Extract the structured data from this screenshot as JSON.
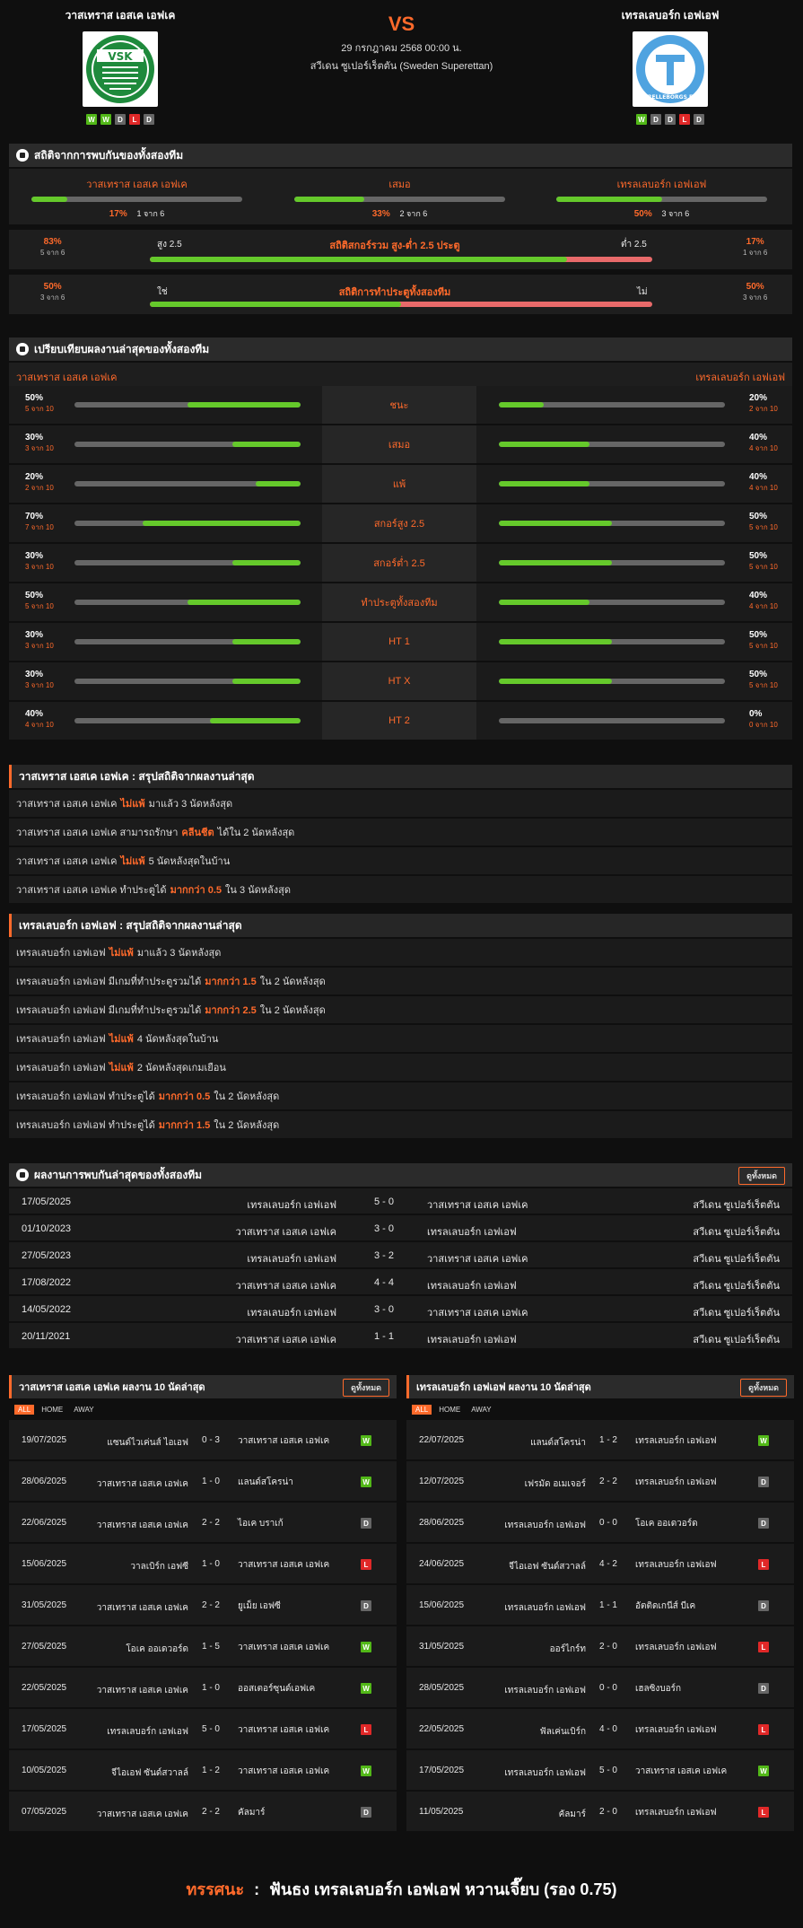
{
  "header": {
    "home": "วาสเทราส เอสเค เอฟเค",
    "away": "เทรลเลบอร์ก เอฟเอฟ",
    "vs": "VS",
    "date": "29 กรกฎาคม 2568 00:00 น.",
    "league": "สวีเดน ซูเปอร์เร็ตตัน (Sweden Superettan)",
    "home_form": [
      "W",
      "W",
      "D",
      "L",
      "D"
    ],
    "away_form": [
      "W",
      "D",
      "D",
      "L",
      "D"
    ],
    "home_logo_text": "VSK",
    "away_logo_text": "TRELLEBORGS FF"
  },
  "h2h_stats": {
    "title": "สถิติจากการพบกันของทั้งสองทีม",
    "home_label": "วาสเทราส เอสเค เอฟเค",
    "draw_label": "เสมอ",
    "away_label": "เทรลเลบอร์ก เอฟเอฟ",
    "home_pct": "17%",
    "home_cnt": "1 จาก 6",
    "draw_pct": "33%",
    "draw_cnt": "2 จาก 6",
    "away_pct": "50%",
    "away_cnt": "3 จาก 6",
    "home_frac": 0.17,
    "draw_frac": 0.33,
    "away_frac": 0.5,
    "ou": {
      "title": "สถิติสกอร์รวม สูง-ต่ำ 2.5 ประตู",
      "left_pct": "83%",
      "left_cnt": "5 จาก 6",
      "right_pct": "17%",
      "right_cnt": "1 จาก 6",
      "over": "สูง 2.5",
      "under": "ต่ำ 2.5",
      "frac": 0.83
    },
    "btts": {
      "title": "สถิติการทำประตูทั้งสองทีม",
      "left_pct": "50%",
      "left_cnt": "3 จาก 6",
      "right_pct": "50%",
      "right_cnt": "3 จาก 6",
      "yes": "ใช่",
      "no": "ไม่",
      "frac": 0.5
    }
  },
  "compare": {
    "title": "เปรียบเทียบผลงานล่าสุดของทั้งสองทีม",
    "home": "วาสเทราส เอสเค เอฟเค",
    "away": "เทรลเลบอร์ก เอฟเอฟ",
    "rows": [
      {
        "label": "ชนะ",
        "hp": "50%",
        "hc": "5 จาก 10",
        "hf": 0.5,
        "ap": "20%",
        "ac": "2 จาก 10",
        "af": 0.2
      },
      {
        "label": "เสมอ",
        "hp": "30%",
        "hc": "3 จาก 10",
        "hf": 0.3,
        "ap": "40%",
        "ac": "4 จาก 10",
        "af": 0.4
      },
      {
        "label": "แพ้",
        "hp": "20%",
        "hc": "2 จาก 10",
        "hf": 0.2,
        "ap": "40%",
        "ac": "4 จาก 10",
        "af": 0.4
      },
      {
        "label": "สกอร์สูง 2.5",
        "hp": "70%",
        "hc": "7 จาก 10",
        "hf": 0.7,
        "ap": "50%",
        "ac": "5 จาก 10",
        "af": 0.5
      },
      {
        "label": "สกอร์ต่ำ 2.5",
        "hp": "30%",
        "hc": "3 จาก 10",
        "hf": 0.3,
        "ap": "50%",
        "ac": "5 จาก 10",
        "af": 0.5
      },
      {
        "label": "ทำประตูทั้งสองทีม",
        "hp": "50%",
        "hc": "5 จาก 10",
        "hf": 0.5,
        "ap": "40%",
        "ac": "4 จาก 10",
        "af": 0.4
      },
      {
        "label": "HT 1",
        "hp": "30%",
        "hc": "3 จาก 10",
        "hf": 0.3,
        "ap": "50%",
        "ac": "5 จาก 10",
        "af": 0.5
      },
      {
        "label": "HT X",
        "hp": "30%",
        "hc": "3 จาก 10",
        "hf": 0.3,
        "ap": "50%",
        "ac": "5 จาก 10",
        "af": 0.5
      },
      {
        "label": "HT 2",
        "hp": "40%",
        "hc": "4 จาก 10",
        "hf": 0.4,
        "ap": "0%",
        "ac": "0 จาก 10",
        "af": 0
      }
    ]
  },
  "summary_home": {
    "title": "วาสเทราส เอสเค เอฟเค : สรุปสถิติจากผลงานล่าสุด",
    "items": [
      [
        "วาสเทราส เอสเค เอฟเค",
        "ไม่แพ้",
        "มาแล้ว 3 นัดหลังสุด"
      ],
      [
        "วาสเทราส เอสเค เอฟเค สามารถรักษา",
        "คลีนชีต",
        "ได้ใน 2 นัดหลังสุด"
      ],
      [
        "วาสเทราส เอสเค เอฟเค",
        "ไม่แพ้",
        "5 นัดหลังสุดในบ้าน"
      ],
      [
        "วาสเทราส เอสเค เอฟเค ทำประตูได้",
        "มากกว่า 0.5",
        "ใน 3 นัดหลังสุด"
      ]
    ]
  },
  "summary_away": {
    "title": "เทรลเลบอร์ก เอฟเอฟ : สรุปสถิติจากผลงานล่าสุด",
    "items": [
      [
        "เทรลเลบอร์ก เอฟเอฟ",
        "ไม่แพ้",
        "มาแล้ว 3 นัดหลังสุด"
      ],
      [
        "เทรลเลบอร์ก เอฟเอฟ มีเกมที่ทำประตูรวมได้",
        "มากกว่า 1.5",
        "ใน 2 นัดหลังสุด"
      ],
      [
        "เทรลเลบอร์ก เอฟเอฟ มีเกมที่ทำประตูรวมได้",
        "มากกว่า 2.5",
        "ใน 2 นัดหลังสุด"
      ],
      [
        "เทรลเลบอร์ก เอฟเอฟ",
        "ไม่แพ้",
        "4 นัดหลังสุดในบ้าน"
      ],
      [
        "เทรลเลบอร์ก เอฟเอฟ",
        "ไม่แพ้",
        "2 นัดหลังสุดเกมเยือน"
      ],
      [
        "เทรลเลบอร์ก เอฟเอฟ ทำประตูได้",
        "มากกว่า 0.5",
        "ใน 2 นัดหลังสุด"
      ],
      [
        "เทรลเลบอร์ก เอฟเอฟ ทำประตูได้",
        "มากกว่า 1.5",
        "ใน 2 นัดหลังสุด"
      ]
    ]
  },
  "h2h_results": {
    "title": "ผลงานการพบกันล่าสุดของทั้งสองทีม",
    "all_btn": "ดูทั้งหมด",
    "rows": [
      [
        "17/05/2025",
        "เทรลเลบอร์ก เอฟเอฟ",
        "5 - 0",
        "วาสเทราส เอสเค เอฟเค",
        "สวีเดน ซูเปอร์เร็ตตัน"
      ],
      [
        "01/10/2023",
        "วาสเทราส เอสเค เอฟเค",
        "3 - 0",
        "เทรลเลบอร์ก เอฟเอฟ",
        "สวีเดน ซูเปอร์เร็ตตัน"
      ],
      [
        "27/05/2023",
        "เทรลเลบอร์ก เอฟเอฟ",
        "3 - 2",
        "วาสเทราส เอสเค เอฟเค",
        "สวีเดน ซูเปอร์เร็ตตัน"
      ],
      [
        "17/08/2022",
        "วาสเทราส เอสเค เอฟเค",
        "4 - 4",
        "เทรลเลบอร์ก เอฟเอฟ",
        "สวีเดน ซูเปอร์เร็ตตัน"
      ],
      [
        "14/05/2022",
        "เทรลเลบอร์ก เอฟเอฟ",
        "3 - 0",
        "วาสเทราส เอสเค เอฟเค",
        "สวีเดน ซูเปอร์เร็ตตัน"
      ],
      [
        "20/11/2021",
        "วาสเทราส เอสเค เอฟเค",
        "1 - 1",
        "เทรลเลบอร์ก เอฟเอฟ",
        "สวีเดน ซูเปอร์เร็ตตัน"
      ]
    ]
  },
  "last_home": {
    "title": "วาสเทราส เอสเค เอฟเค ผลงาน 10 นัดล่าสุด",
    "all_btn": "ดูทั้งหมด",
    "tabs": [
      "ALL",
      "HOME",
      "AWAY"
    ],
    "rows": [
      [
        "19/07/2025",
        "แซนด์ไวเค่นส์ ไอเอฟ",
        "0 - 3",
        "วาสเทราส เอสเค เอฟเค",
        "W"
      ],
      [
        "28/06/2025",
        "วาสเทราส เอสเค เอฟเค",
        "1 - 0",
        "แลนด์สโครน่า",
        "W"
      ],
      [
        "22/06/2025",
        "วาสเทราส เอสเค เอฟเค",
        "2 - 2",
        "ไอเค บราเก้",
        "D"
      ],
      [
        "15/06/2025",
        "วาลเบิร์ก เอฟซี",
        "1 - 0",
        "วาสเทราส เอสเค เอฟเค",
        "L"
      ],
      [
        "31/05/2025",
        "วาสเทราส เอสเค เอฟเค",
        "2 - 2",
        "ยูเม็ย เอฟซี",
        "D"
      ],
      [
        "27/05/2025",
        "โอเค ออเดวอร์ด",
        "1 - 5",
        "วาสเทราส เอสเค เอฟเค",
        "W"
      ],
      [
        "22/05/2025",
        "วาสเทราส เอสเค เอฟเค",
        "1 - 0",
        "ออสเตอร์ซุนด์เอฟเค",
        "W"
      ],
      [
        "17/05/2025",
        "เทรลเลบอร์ก เอฟเอฟ",
        "5 - 0",
        "วาสเทราส เอสเค เอฟเค",
        "L"
      ],
      [
        "10/05/2025",
        "จีไอเอฟ ซันด์สวาลล์",
        "1 - 2",
        "วาสเทราส เอสเค เอฟเค",
        "W"
      ],
      [
        "07/05/2025",
        "วาสเทราส เอสเค เอฟเค",
        "2 - 2",
        "คัลมาร์",
        "D"
      ]
    ]
  },
  "last_away": {
    "title": "เทรลเลบอร์ก เอฟเอฟ ผลงาน 10 นัดล่าสุด",
    "all_btn": "ดูทั้งหมด",
    "tabs": [
      "ALL",
      "HOME",
      "AWAY"
    ],
    "rows": [
      [
        "22/07/2025",
        "แลนด์สโครน่า",
        "1 - 2",
        "เทรลเลบอร์ก เอฟเอฟ",
        "W"
      ],
      [
        "12/07/2025",
        "เฟรมัด อเมเจอร์",
        "2 - 2",
        "เทรลเลบอร์ก เอฟเอฟ",
        "D"
      ],
      [
        "28/06/2025",
        "เทรลเลบอร์ก เอฟเอฟ",
        "0 - 0",
        "โอเค ออเดวอร์ด",
        "D"
      ],
      [
        "24/06/2025",
        "จีไอเอฟ ซันด์สวาลล์",
        "4 - 2",
        "เทรลเลบอร์ก เอฟเอฟ",
        "L"
      ],
      [
        "15/06/2025",
        "เทรลเลบอร์ก เอฟเอฟ",
        "1 - 1",
        "อัตติดเกนีส์ บีเค",
        "D"
      ],
      [
        "31/05/2025",
        "ออร์ไกร์ท",
        "2 - 0",
        "เทรลเลบอร์ก เอฟเอฟ",
        "L"
      ],
      [
        "28/05/2025",
        "เทรลเลบอร์ก เอฟเอฟ",
        "0 - 0",
        "เฮลซิงบอร์ก",
        "D"
      ],
      [
        "22/05/2025",
        "ฟัลเค่นเบิร์ก",
        "4 - 0",
        "เทรลเลบอร์ก เอฟเอฟ",
        "L"
      ],
      [
        "17/05/2025",
        "เทรลเลบอร์ก เอฟเอฟ",
        "5 - 0",
        "วาสเทราส เอสเค เอฟเค",
        "W"
      ],
      [
        "11/05/2025",
        "คัลมาร์",
        "2 - 0",
        "เทรลเลบอร์ก เอฟเอฟ",
        "L"
      ]
    ]
  },
  "footer": {
    "label": "ทรรศนะ",
    "sep": ":",
    "text": "ฟันธง เทรลเลบอร์ก เอฟเอฟ หวานเจี๊ยบ (รอง 0.75)"
  }
}
